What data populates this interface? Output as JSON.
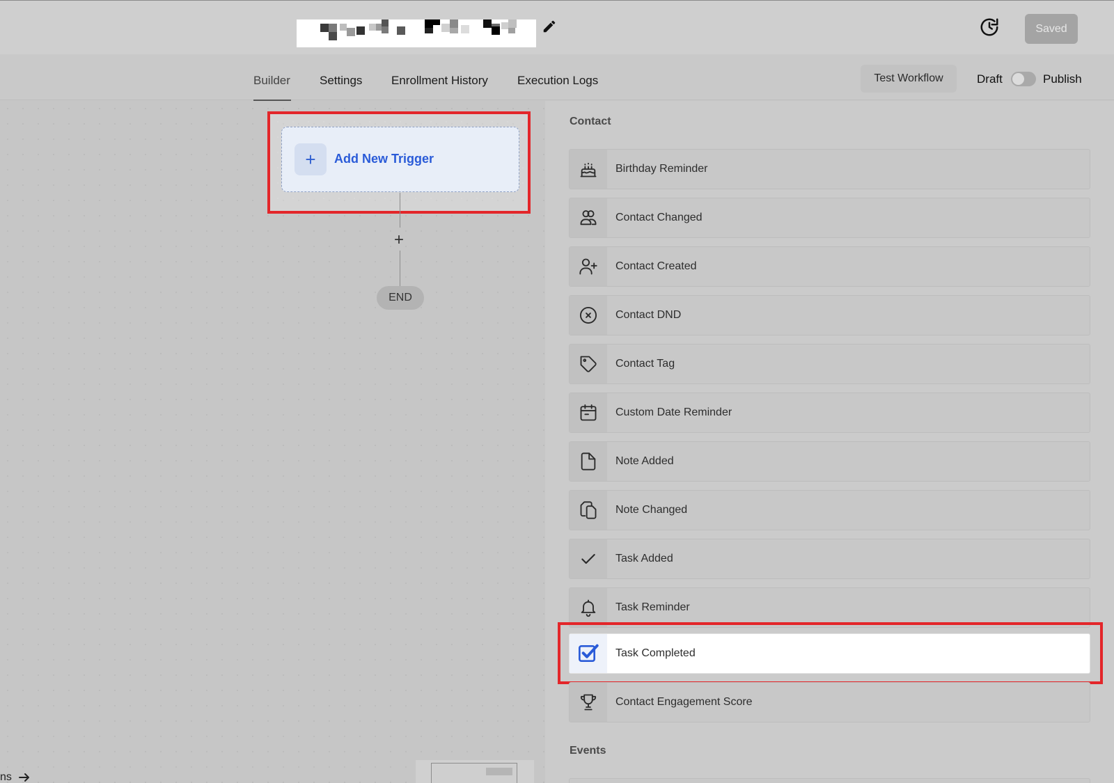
{
  "header": {
    "workflow_title": "",
    "saved_label": "Saved",
    "edit_icon": "pencil-icon",
    "history_icon": "history-icon"
  },
  "tabs": [
    {
      "label": "Builder",
      "active": true
    },
    {
      "label": "Settings",
      "active": false
    },
    {
      "label": "Enrollment History",
      "active": false
    },
    {
      "label": "Execution Logs",
      "active": false
    }
  ],
  "toolbar": {
    "test_workflow_label": "Test Workflow",
    "draft_label": "Draft",
    "publish_label": "Publish",
    "publish_toggle_on": false
  },
  "canvas": {
    "add_trigger_label": "Add New Trigger",
    "add_step_symbol": "+",
    "end_label": "END",
    "bottom_left_text": "ns"
  },
  "panel": {
    "section_contact": "Contact",
    "section_events": "Events",
    "triggers": [
      {
        "label": "Birthday Reminder",
        "icon": "birthday-cake-icon"
      },
      {
        "label": "Contact Changed",
        "icon": "users-icon"
      },
      {
        "label": "Contact Created",
        "icon": "user-plus-icon"
      },
      {
        "label": "Contact DND",
        "icon": "circle-x-icon"
      },
      {
        "label": "Contact Tag",
        "icon": "tag-icon"
      },
      {
        "label": "Custom Date Reminder",
        "icon": "calendar-icon"
      },
      {
        "label": "Note Added",
        "icon": "file-icon"
      },
      {
        "label": "Note Changed",
        "icon": "files-icon"
      },
      {
        "label": "Task Added",
        "icon": "check-icon"
      },
      {
        "label": "Task Reminder",
        "icon": "bell-icon"
      },
      {
        "label": "Task Completed",
        "icon": "checkbox-checked-icon",
        "selected": true
      },
      {
        "label": "Contact Engagement Score",
        "icon": "trophy-icon"
      }
    ]
  },
  "colors": {
    "accent_blue": "#2a5bd8",
    "highlight_red": "#e3262a"
  }
}
